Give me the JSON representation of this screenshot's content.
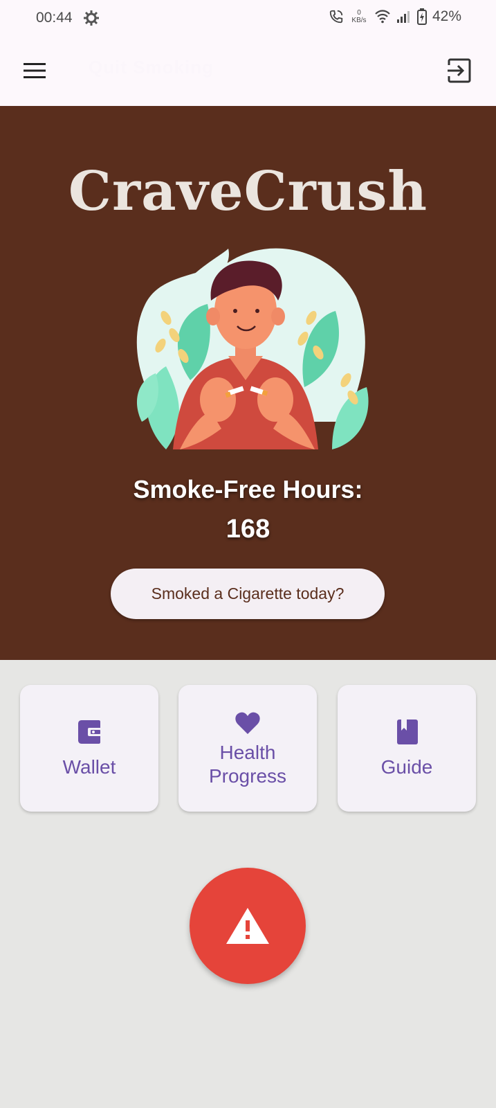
{
  "status_bar": {
    "time": "00:44",
    "data_rate_value": "0",
    "data_rate_unit": "KB/s",
    "battery": "42%",
    "icons": [
      "settings-icon",
      "wifi-call-icon",
      "wifi-icon",
      "signal-icon",
      "battery-charging-icon"
    ]
  },
  "app_bar": {
    "title": "Quit Smoking",
    "menu_icon": "hamburger-menu-icon",
    "logout_icon": "logout-icon"
  },
  "hero": {
    "brand": "CraveCrush",
    "hours_label": "Smoke-Free Hours:",
    "hours_value": "168",
    "smoked_button": "Smoked a Cigarette today?",
    "background_color": "#5a2e1d"
  },
  "cards": [
    {
      "label": "Wallet",
      "icon": "wallet-icon"
    },
    {
      "label": "Health\nProgress",
      "icon": "heart-icon"
    },
    {
      "label": "Guide",
      "icon": "book-icon"
    }
  ],
  "sos_button": {
    "icon": "warning-icon",
    "color": "#e5443a"
  },
  "colors": {
    "accent": "#6a4fa7",
    "page_background": "#e6e6e4"
  }
}
